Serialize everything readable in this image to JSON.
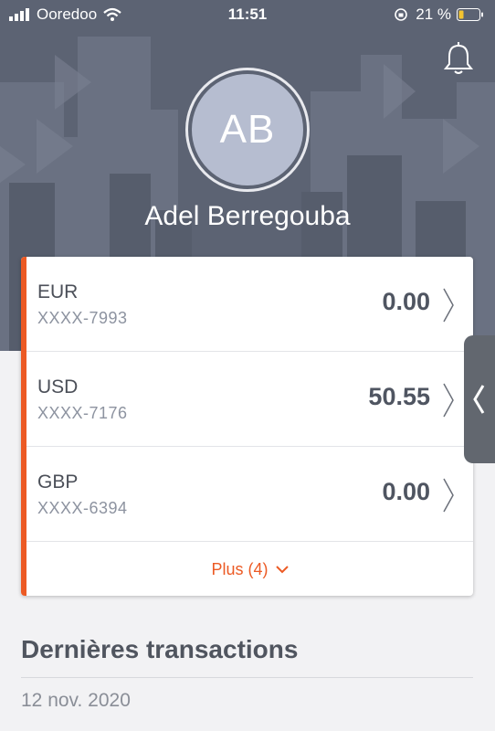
{
  "status_bar": {
    "carrier": "Ooredoo",
    "time": "11:51",
    "battery": "21 %"
  },
  "profile": {
    "initials": "AB",
    "name": "Adel Berregouba"
  },
  "accounts": [
    {
      "currency": "EUR",
      "number": "XXXX-7993",
      "balance": "0.00"
    },
    {
      "currency": "USD",
      "number": "XXXX-7176",
      "balance": "50.55"
    },
    {
      "currency": "GBP",
      "number": "XXXX-6394",
      "balance": "0.00"
    }
  ],
  "more_label": "Plus (4)",
  "transactions": {
    "title": "Dernières transactions",
    "date": "12 nov. 2020"
  },
  "colors": {
    "accent": "#ec5a24",
    "header": "#5c6373",
    "avatar": "#b6bdd0"
  },
  "icons": {
    "bell": "bell-icon",
    "chevron": "chevron-right-icon",
    "expand": "chevron-down-icon",
    "side_tab": "chevron-left-icon"
  }
}
